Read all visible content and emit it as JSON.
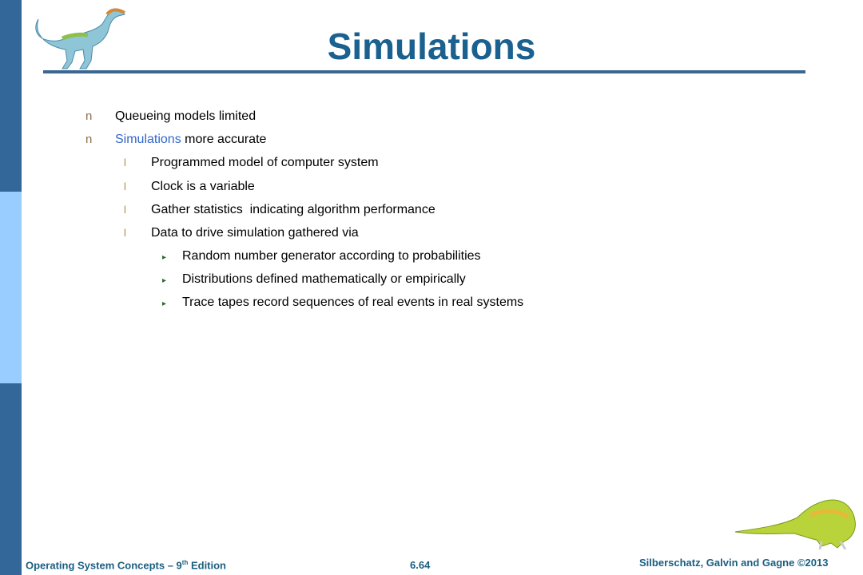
{
  "slide": {
    "title": "Simulations",
    "bullets": [
      {
        "level": 1,
        "marker": "n",
        "text": "Queueing models limited"
      },
      {
        "level": 1,
        "marker": "n",
        "highlight": "Simulations",
        "text": " more accurate"
      },
      {
        "level": 2,
        "marker": "l",
        "text": "Programmed model of computer system"
      },
      {
        "level": 2,
        "marker": "l",
        "text": "Clock is a variable"
      },
      {
        "level": 2,
        "marker": "l",
        "text": "Gather statistics  indicating algorithm performance"
      },
      {
        "level": 2,
        "marker": "l",
        "text": "Data to drive simulation gathered via"
      },
      {
        "level": 3,
        "marker": "▸",
        "text": "Random number generator according to probabilities"
      },
      {
        "level": 3,
        "marker": "▸",
        "text": "Distributions defined mathematically or empirically"
      },
      {
        "level": 3,
        "marker": "▸",
        "text": "Trace tapes record sequences of real events in real systems"
      }
    ]
  },
  "footer": {
    "book": "Operating System Concepts – 9",
    "edition_sup": "th",
    "edition_word": " Edition",
    "page": "6.64",
    "copyright": "Silberschatz, Galvin and Gagne ©2013"
  },
  "colors": {
    "sidebar_dark": "#336699",
    "sidebar_light": "#99ccff",
    "title": "#1a6190",
    "highlight": "#3366cc"
  }
}
